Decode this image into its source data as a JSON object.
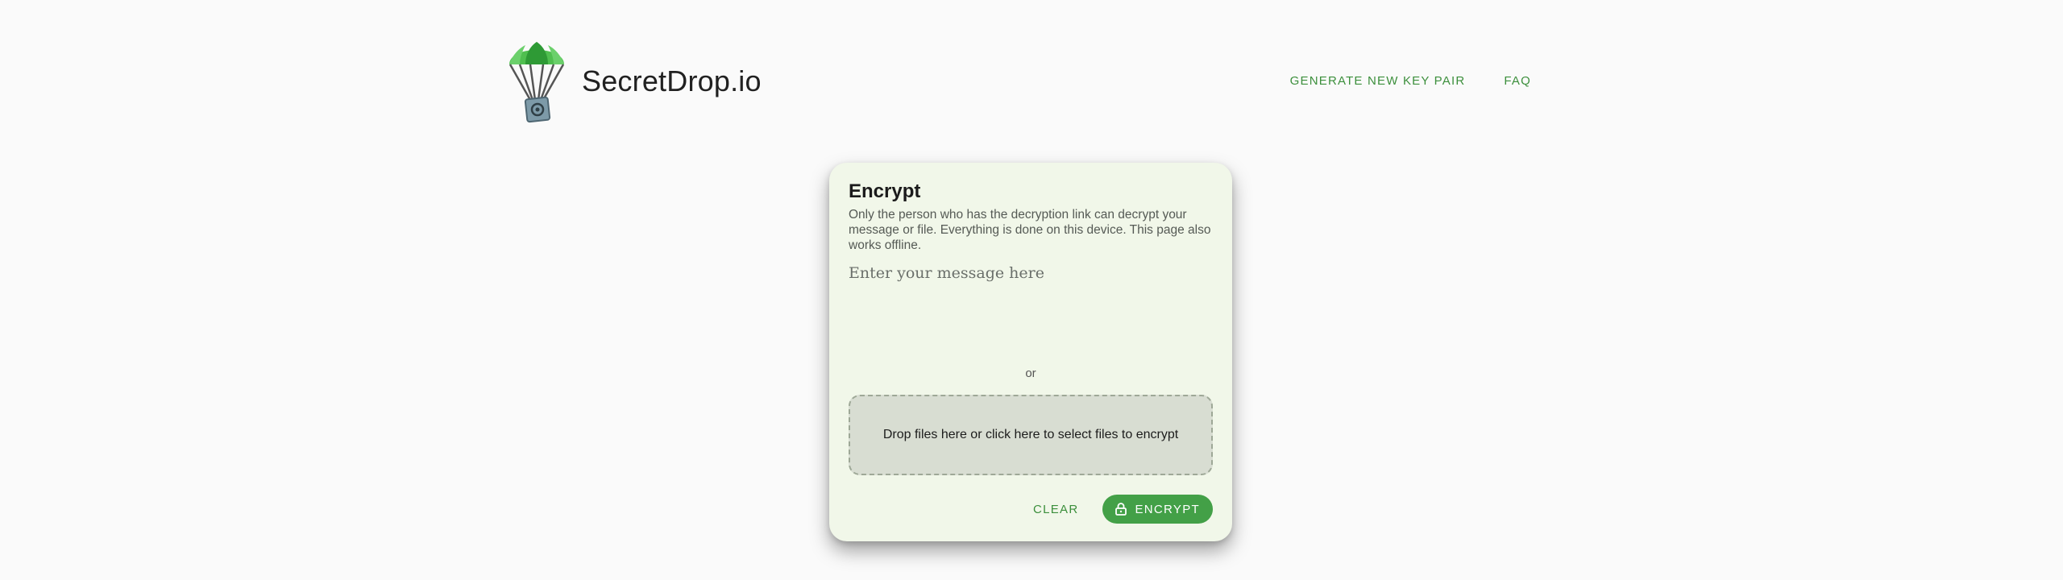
{
  "header": {
    "brand": "SecretDrop.io",
    "logo_icon": "parachute-safe-icon",
    "nav": [
      {
        "label": "GENERATE NEW KEY PAIR"
      },
      {
        "label": "FAQ"
      }
    ]
  },
  "card": {
    "title": "Encrypt",
    "description": "Only the person who has the decryption link can decrypt your message or file. Everything is done on this device. This page also works offline.",
    "message_placeholder": "Enter your message here",
    "message_value": "",
    "or_text": "or",
    "dropzone_text": "Drop files here or click here to select files to encrypt",
    "clear_label": "CLEAR",
    "encrypt_label": "ENCRYPT",
    "encrypt_icon": "lock-icon"
  },
  "colors": {
    "accent": "#43a047",
    "link": "#3c8f3c",
    "card_bg": "#f1f7e9",
    "dropzone_bg": "#d8ddd2",
    "page_bg": "#fafafa"
  }
}
